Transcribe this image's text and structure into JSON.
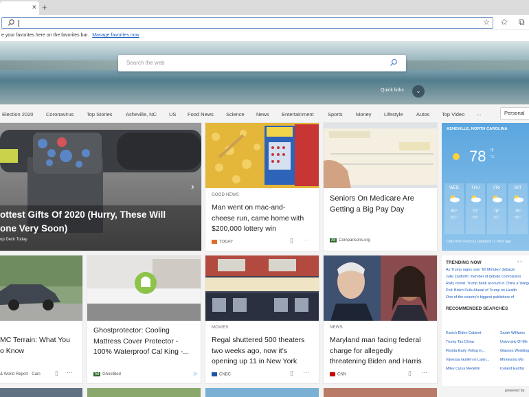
{
  "tabbar": {
    "close": "×",
    "new_tab": "+"
  },
  "toolbar": {
    "star": "☆",
    "favorites_icon": "✩",
    "collections_icon": "⧉",
    "profile_icon": "☺"
  },
  "favorites_bar": {
    "prompt": "e your favorites here on the favorites bar.",
    "link": "Manage favorites now"
  },
  "hero": {
    "search_placeholder": "Search the web",
    "quick_links": "Quick links",
    "chevron": "⌄"
  },
  "nav": {
    "items": [
      "Election 2020",
      "Coronavirus",
      "Top Stories",
      "Asheville, NC",
      "US",
      "Food News",
      "Science",
      "News",
      "Entertainment",
      "Sports",
      "Money",
      "Lifestyle",
      "Autos",
      "Top Video",
      "···"
    ],
    "personalize": "Personal"
  },
  "cards": {
    "hero_card": {
      "title": "ottest Gifts Of 2020 (Hurry, These Will one Very Soon)",
      "title_l1": "ottest Gifts Of 2020 (Hurry, These Will",
      "title_l2": "one Very Soon)",
      "source": "op Deck Today",
      "arrow": "›"
    },
    "mac": {
      "label": "GOOD NEWS",
      "title_l1": "Man went on mac-and-",
      "title_l2": "cheese run, came home with",
      "title_l3": "$200,000 lottery win",
      "source": "TODAY"
    },
    "medicare": {
      "title_l1": "Seniors On Medicare Are",
      "title_l2": "Getting a Big Pay Day",
      "source": "Comparisons.org",
      "ad": "Ad"
    },
    "gmc": {
      "title_l1": "MC Terrain: What You",
      "title_l2": "o Know",
      "source": "& World Report · Cars"
    },
    "ghost": {
      "title_l1": "Ghostprotector: Cooling",
      "title_l2": "Mattress Cover Protector -",
      "title_l3": "100% Waterproof Cal King -...",
      "source": "GhostBed",
      "ad": "Ad"
    },
    "regal": {
      "label": "MOVIES",
      "title_l1": "Regal shuttered 500 theaters",
      "title_l2": "two weeks ago, now it's",
      "title_l3": "opening up 11 in New York",
      "source": "CNBC"
    },
    "maryland": {
      "label": "NEWS",
      "title_l1": "Maryland man facing federal",
      "title_l2": "charge for allegedly",
      "title_l3": "threatening Biden and Harris",
      "source": "CNN"
    }
  },
  "weather": {
    "location": "ASHEVILLE, NORTH CAROLINA",
    "temp": "78",
    "unit_f": "°F",
    "unit_c": "°C",
    "days": [
      {
        "d": "WED",
        "hi": "80°",
        "lo": "62°"
      },
      {
        "d": "THU",
        "hi": "72°",
        "lo": "59°"
      },
      {
        "d": "FRI",
        "hi": "78°",
        "lo": "52°"
      },
      {
        "d": "SAT",
        "hi": "75°",
        "lo": "50°"
      }
    ],
    "footer": "Data from Foreca | Updated 17 mins ago"
  },
  "trending": {
    "heading": "TRENDING NOW",
    "nav": "‹ ›",
    "items": [
      "As Trump rages over '60 Minutes' debacle",
      "Julie Zanforth: member of debate commission",
      "Rally crowd. Trump bank account in China a 'dangerous'",
      "Poll: Biden Pulls Ahead of Trump on Health",
      "One of the country's biggest publishers of"
    ],
    "rec_heading": "RECOMMENDED SEARCHES",
    "rec_left": [
      "Kavich Biden Cabinet",
      "Trump Tax China",
      "Florida Early Voting in...",
      "Vanessa Guillen in Lawn...",
      "Miley Cyrus Medellín"
    ],
    "rec_right": [
      "Sarah Williams",
      "University Of Me",
      "Glasses Wedding",
      "Minnesota Ma",
      "Iceland Earthq"
    ],
    "powered": "powered by"
  },
  "colors": {
    "accent": "#1a5bbf",
    "weather_top": "#5ba6df"
  }
}
